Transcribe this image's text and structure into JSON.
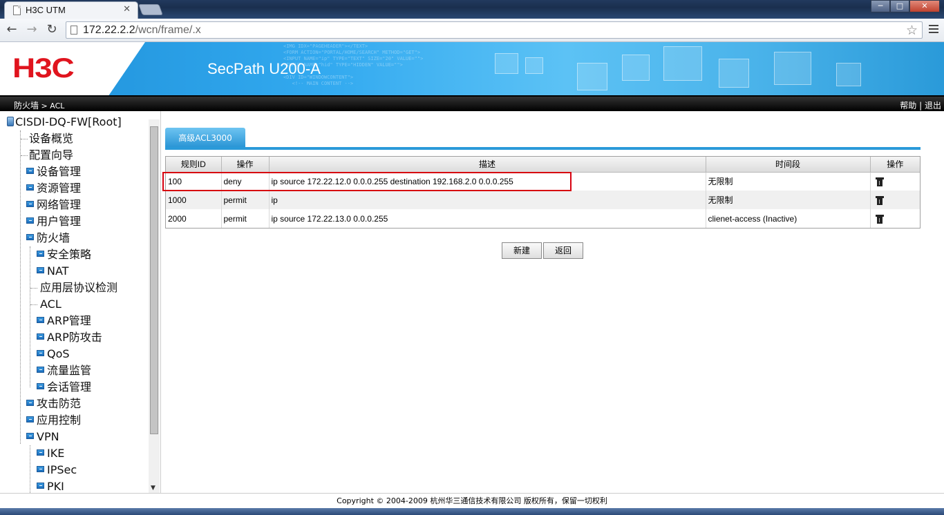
{
  "browser": {
    "tab_title": "H3C UTM",
    "tab_close": "✕",
    "url_host": "172.22.2.2",
    "url_path": "/wcn/frame/.x",
    "window_buttons": {
      "minimize": "─",
      "maximize": "□",
      "close": "✕"
    }
  },
  "header": {
    "logo": "H3C",
    "product": "SecPath U200-A"
  },
  "navbar": {
    "crumb_root": "防火墙",
    "crumb_sep": " > ",
    "crumb_leaf": "ACL",
    "help": "帮助",
    "sep": " | ",
    "logout": "退出"
  },
  "sidebar": {
    "root": "CISDI-DQ-FW[Root]",
    "items": [
      {
        "label": "设备概览"
      },
      {
        "label": "配置向导"
      },
      {
        "label": "设备管理"
      },
      {
        "label": "资源管理"
      },
      {
        "label": "网络管理"
      },
      {
        "label": "用户管理"
      },
      {
        "label": "防火墙"
      },
      {
        "label": "安全策略"
      },
      {
        "label": "NAT"
      },
      {
        "label": "应用层协议检测"
      },
      {
        "label": "ACL"
      },
      {
        "label": "ARP管理"
      },
      {
        "label": "ARP防攻击"
      },
      {
        "label": "QoS"
      },
      {
        "label": "流量监管"
      },
      {
        "label": "会话管理"
      },
      {
        "label": "攻击防范"
      },
      {
        "label": "应用控制"
      },
      {
        "label": "VPN"
      },
      {
        "label": "IKE"
      },
      {
        "label": "IPSec"
      },
      {
        "label": "PKI"
      }
    ]
  },
  "main": {
    "tab_label": "高级ACL3000",
    "columns": [
      "规则ID",
      "操作",
      "描述",
      "时间段",
      "操作"
    ],
    "rows": [
      {
        "id": "100",
        "action": "deny",
        "desc": "ip source 172.22.12.0 0.0.0.255 destination 192.168.2.0 0.0.0.255",
        "time": "无限制"
      },
      {
        "id": "1000",
        "action": "permit",
        "desc": "ip",
        "time": "无限制"
      },
      {
        "id": "2000",
        "action": "permit",
        "desc": "ip source 172.22.13.0 0.0.0.255",
        "time": "clienet-access (Inactive)"
      }
    ],
    "new_button": "新建",
    "back_button": "返回"
  },
  "footer": {
    "copyright": "Copyright © 2004-2009 杭州华三通信技术有限公司 版权所有，保留一切权利"
  },
  "icons": [
    "page-icon",
    "back-arrow-icon",
    "forward-arrow-icon",
    "reload-icon",
    "star-icon",
    "wrench-icon",
    "server-icon",
    "expand-icon",
    "trash-icon"
  ],
  "colors": {
    "brand_red": "#e0141e",
    "banner_blue": "#33aaf0",
    "highlight_red": "#d7000f",
    "tab_blue": "#2a9ad9"
  }
}
